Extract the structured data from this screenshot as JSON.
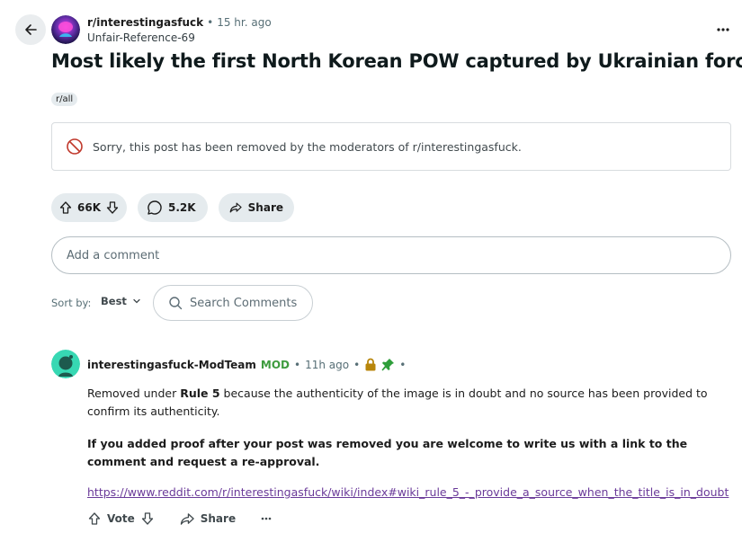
{
  "post": {
    "subreddit": "r/interestingasfuck",
    "time": "15 hr. ago",
    "author": "Unfair-Reference-69",
    "title": "Most likely the first North Korean POW captured by Ukrainian forces",
    "flair": "r/all",
    "removed_notice": "Sorry, this post has been removed by the moderators of r/interestingasfuck.",
    "upvotes": "66K",
    "comments_count": "5.2K",
    "share_label": "Share",
    "more_icon": "more-horizontal-icon"
  },
  "comment_box": {
    "placeholder": "Add a comment"
  },
  "sort": {
    "label": "Sort by:",
    "value": "Best"
  },
  "search": {
    "placeholder": "Search Comments"
  },
  "comment": {
    "author": "interestingasfuck-ModTeam",
    "badge": "MOD",
    "time": "11h ago",
    "body_pre": "Removed under ",
    "body_rule": "Rule 5",
    "body_post": " because the authenticity of the image is in doubt and no source has been provided to confirm its authenticity.",
    "body_bold": "If you added proof after your post was removed you are welcome to write us with a link to the comment and request a re-approval.",
    "link": "https://www.reddit.com/r/interestingasfuck/wiki/index#wiki_rule_5_-_provide_a_source_when_the_title_is_in_doubt",
    "vote_label": "Vote",
    "share_label": "Share",
    "icons": [
      "lock-icon",
      "pin-icon"
    ]
  },
  "colors": {
    "accent_mod": "#3f9c3f",
    "pill_bg": "#e5ebee",
    "removed_icon": "#c0382b",
    "link_visited": "#6a3a99"
  }
}
